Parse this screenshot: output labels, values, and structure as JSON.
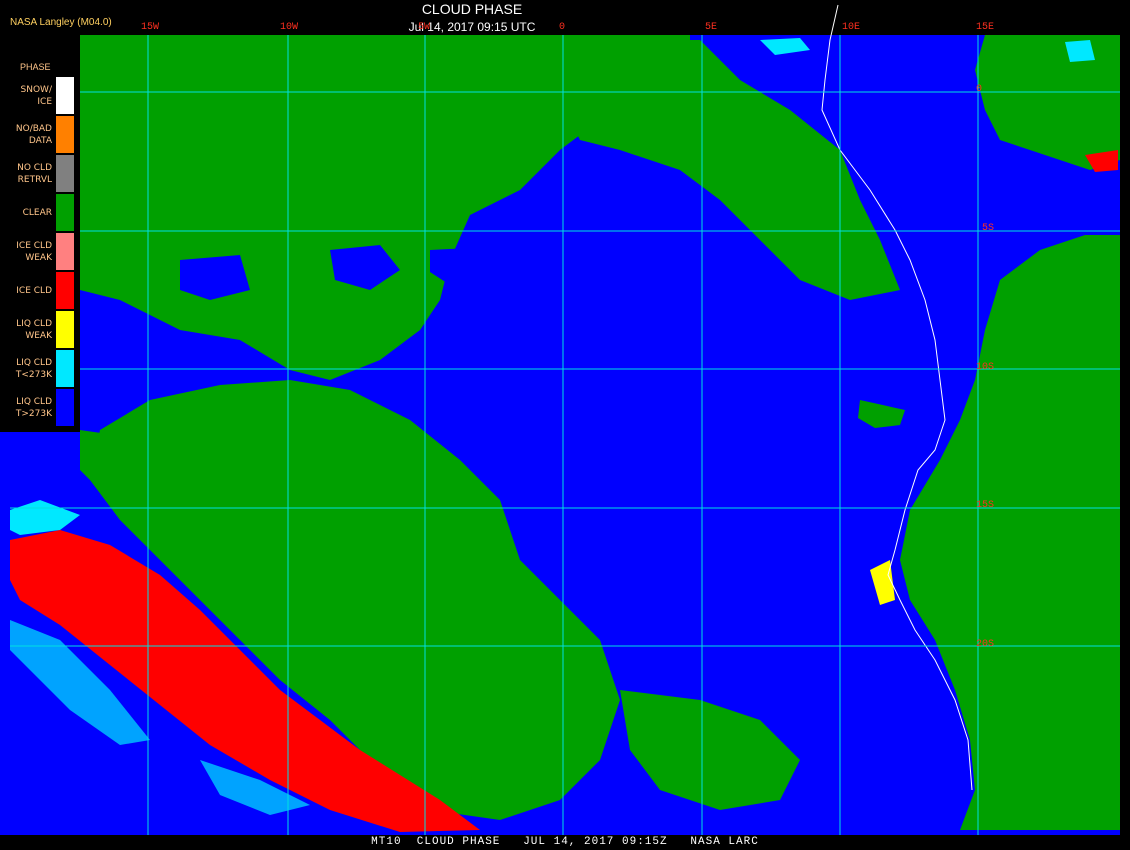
{
  "header": {
    "credit": "NASA Langley (M04.0)",
    "title": "CLOUD PHASE",
    "subtitle": "Jul 14, 2017 09:15 UTC"
  },
  "footer": {
    "text": "MT10  CLOUD PHASE   JUL 14, 2017 09:15Z   NASA LARC"
  },
  "legend": {
    "title": "PHASE",
    "items": [
      {
        "label": "SNOW/\nICE",
        "color": "#ffffff"
      },
      {
        "label": "NO/BAD\nDATA",
        "color": "#ff8000"
      },
      {
        "label": "NO CLD\nRETRVL",
        "color": "#808080"
      },
      {
        "label": "CLEAR",
        "color": "#00a000"
      },
      {
        "label": "ICE CLD\nWEAK",
        "color": "#ff8080"
      },
      {
        "label": "ICE CLD",
        "color": "#ff0000"
      },
      {
        "label": "LIQ CLD\nWEAK",
        "color": "#ffff00"
      },
      {
        "label": "LIQ CLD\nT<273K",
        "color": "#00e8ff"
      },
      {
        "label": "LIQ CLD\nT>273K",
        "color": "#0000ff"
      }
    ]
  },
  "grid": {
    "longitude_labels": [
      "15W",
      "10W",
      "5W",
      "0",
      "5E",
      "10E",
      "15E"
    ],
    "latitude_labels": [
      "0",
      "5S",
      "10S",
      "15S",
      "20S"
    ]
  },
  "colors": {
    "ocean_liquid_cloud": "#0000ff",
    "clear": "#00a000",
    "ice_cloud": "#ff0000",
    "liquid_cold": "#00e8ff",
    "grid": "#00e0e0",
    "coast": "#ffffff"
  }
}
